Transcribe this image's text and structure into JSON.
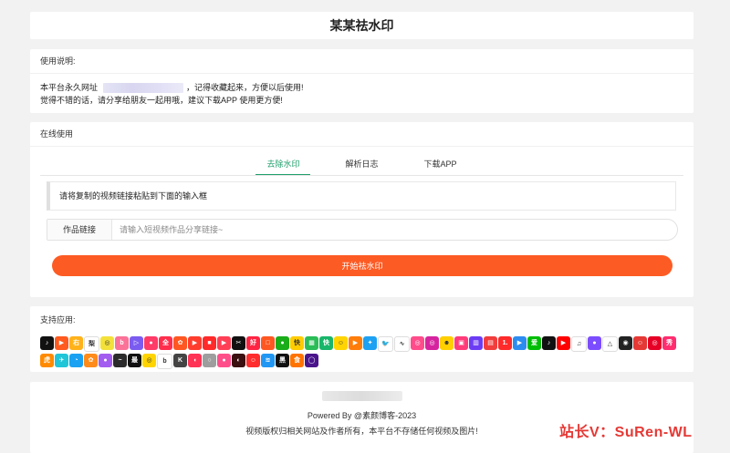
{
  "header": {
    "title": "某某祛水印"
  },
  "usage": {
    "heading": "使用说明:",
    "line1_prefix": "本平台永久网址",
    "line1_suffix": "，记得收藏起来，方便以后使用!",
    "line2": "觉得不错的话，请分享给朋友一起用哦，建议下载APP 使用更方便!"
  },
  "online": {
    "heading": "在线使用",
    "tabs": [
      {
        "label": "去除水印",
        "active": true
      },
      {
        "label": "解析日志",
        "active": false
      },
      {
        "label": "下载APP",
        "active": false
      }
    ],
    "tip": "请将复制的视频链接粘贴到下面的输入框",
    "input_label": "作品链接",
    "input_placeholder": "请输入短视频作品分享链接~",
    "input_value": "",
    "button_label": "开始祛水印"
  },
  "support": {
    "heading": "支持应用:",
    "apps": [
      {
        "icon": "douyin-icon",
        "color": "#111111",
        "glyph": "♪"
      },
      {
        "icon": "kuaishou-icon",
        "color": "#ff5a1f",
        "glyph": "▶"
      },
      {
        "icon": "zuiyou-icon",
        "color": "#ffb21a",
        "glyph": "右"
      },
      {
        "icon": "lishipin-icon",
        "color": "#ffffff",
        "glyph": "梨"
      },
      {
        "icon": "weibo-icon",
        "color": "#f3e13a",
        "glyph": "◎"
      },
      {
        "icon": "bilibili-icon",
        "color": "#fb7299",
        "glyph": "b"
      },
      {
        "icon": "miaopai-icon",
        "color": "#7b5cf0",
        "glyph": "▷"
      },
      {
        "icon": "momo-icon",
        "color": "#ff3b68",
        "glyph": "●"
      },
      {
        "icon": "quanmin-icon",
        "color": "#ff2e4d",
        "glyph": "全"
      },
      {
        "icon": "huoshan-icon",
        "color": "#ff5722",
        "glyph": "✿"
      },
      {
        "icon": "xigua-icon",
        "color": "#ff3d2e",
        "glyph": "▶"
      },
      {
        "icon": "video-red-icon",
        "color": "#ff2a2a",
        "glyph": "■"
      },
      {
        "icon": "weishi-icon",
        "color": "#ff3f56",
        "glyph": "▶"
      },
      {
        "icon": "capcut-icon",
        "color": "#111111",
        "glyph": "✂"
      },
      {
        "icon": "haokan-icon",
        "color": "#ff2442",
        "glyph": "好"
      },
      {
        "icon": "tv-icon",
        "color": "#ff5722",
        "glyph": "□"
      },
      {
        "icon": "liuliu-icon",
        "color": "#1aad19",
        "glyph": "●"
      },
      {
        "icon": "kuaikan-icon",
        "color": "#ffcc00",
        "glyph": "快"
      },
      {
        "icon": "green-app-icon",
        "color": "#2bbd57",
        "glyph": "▦"
      },
      {
        "icon": "kuaishou-speed-icon",
        "color": "#18b66a",
        "glyph": "快"
      },
      {
        "icon": "face-icon",
        "color": "#ffd400",
        "glyph": "☺"
      },
      {
        "icon": "play-orange-icon",
        "color": "#ff7d0a",
        "glyph": "▶"
      },
      {
        "icon": "twitter-icon",
        "color": "#1da1f2",
        "glyph": "✦"
      },
      {
        "icon": "bird-icon",
        "color": "#ffffff",
        "glyph": "🐦"
      },
      {
        "icon": "wave-icon",
        "color": "#ffffff",
        "glyph": "∿"
      },
      {
        "icon": "circle-pink-icon",
        "color": "#ff4c8b",
        "glyph": "◎"
      },
      {
        "icon": "instagram-icon",
        "color": "#d6249f",
        "glyph": "◎"
      },
      {
        "icon": "face-yellow-icon",
        "color": "#ffcf00",
        "glyph": "☻"
      },
      {
        "icon": "pink-box-icon",
        "color": "#ff3b7a",
        "glyph": "▣"
      },
      {
        "icon": "purple-app-icon",
        "color": "#6c3cf5",
        "glyph": "▥"
      },
      {
        "icon": "red-tv-icon",
        "color": "#f23d3d",
        "glyph": "▤"
      },
      {
        "icon": "one-icon",
        "color": "#ff2a2a",
        "glyph": "1."
      },
      {
        "icon": "blue-play-icon",
        "color": "#2d8cf0",
        "glyph": "▶"
      },
      {
        "icon": "iqiyi-icon",
        "color": "#00be06",
        "glyph": "爱"
      },
      {
        "icon": "tiktok-icon",
        "color": "#111111",
        "glyph": "♪"
      },
      {
        "icon": "youtube-icon",
        "color": "#ff0000",
        "glyph": "▶"
      },
      {
        "icon": "yinfu-icon",
        "color": "#ffffff",
        "glyph": "♫"
      },
      {
        "icon": "chat-purple-icon",
        "color": "#7c4dff",
        "glyph": "●"
      },
      {
        "icon": "triangle-icon",
        "color": "#ffffff",
        "glyph": "△"
      },
      {
        "icon": "black-circle-icon",
        "color": "#222222",
        "glyph": "◉"
      },
      {
        "icon": "red-face-icon",
        "color": "#e53935",
        "glyph": "☺"
      },
      {
        "icon": "netease-icon",
        "color": "#e60026",
        "glyph": "◎"
      },
      {
        "icon": "pink-label-icon",
        "color": "#ff2d6f",
        "glyph": "秀"
      },
      {
        "icon": "tiger-icon",
        "color": "#ff8a00",
        "glyph": "虎"
      },
      {
        "icon": "cyan-icon",
        "color": "#20c5d8",
        "glyph": "✈"
      },
      {
        "icon": "penguin-icon",
        "color": "#1aa1f2",
        "glyph": "◔"
      },
      {
        "icon": "orange-fox-icon",
        "color": "#ff8c1a",
        "glyph": "✿"
      },
      {
        "icon": "purple-icon",
        "color": "#a35cf0",
        "glyph": "●"
      },
      {
        "icon": "dark-wave-icon",
        "color": "#2b2b2b",
        "glyph": "~"
      },
      {
        "icon": "zuiyou-black-icon",
        "color": "#111111",
        "glyph": "最"
      },
      {
        "icon": "yellow-icon",
        "color": "#ffd400",
        "glyph": "◎"
      },
      {
        "icon": "b-icon",
        "color": "#ffffff",
        "glyph": "b"
      },
      {
        "icon": "k-icon",
        "color": "#444444",
        "glyph": "K"
      },
      {
        "icon": "red-pill-icon",
        "color": "#ff3355",
        "glyph": "◖"
      },
      {
        "icon": "grey-icon",
        "color": "#9e9e9e",
        "glyph": "○"
      },
      {
        "icon": "pink-icon",
        "color": "#ff4f8b",
        "glyph": "●"
      },
      {
        "icon": "dark-red-icon",
        "color": "#3b1010",
        "glyph": "◐"
      },
      {
        "icon": "red-smile-icon",
        "color": "#ff2d2d",
        "glyph": "☺"
      },
      {
        "icon": "blue-wave-icon",
        "color": "#2196f3",
        "glyph": "≋"
      },
      {
        "icon": "black-text-icon",
        "color": "#111111",
        "glyph": "黑"
      },
      {
        "icon": "food-icon",
        "color": "#ff7300",
        "glyph": "食"
      },
      {
        "icon": "ring-icon",
        "color": "#4a148c",
        "glyph": "◯"
      }
    ]
  },
  "footer": {
    "powered": "Powered By @素颜博客-2023",
    "disclaimer": "视频版权归相关网站及作者所有，本平台不存储任何视频及图片!"
  },
  "watermark": {
    "text": "站长V：SuRen-WL"
  }
}
